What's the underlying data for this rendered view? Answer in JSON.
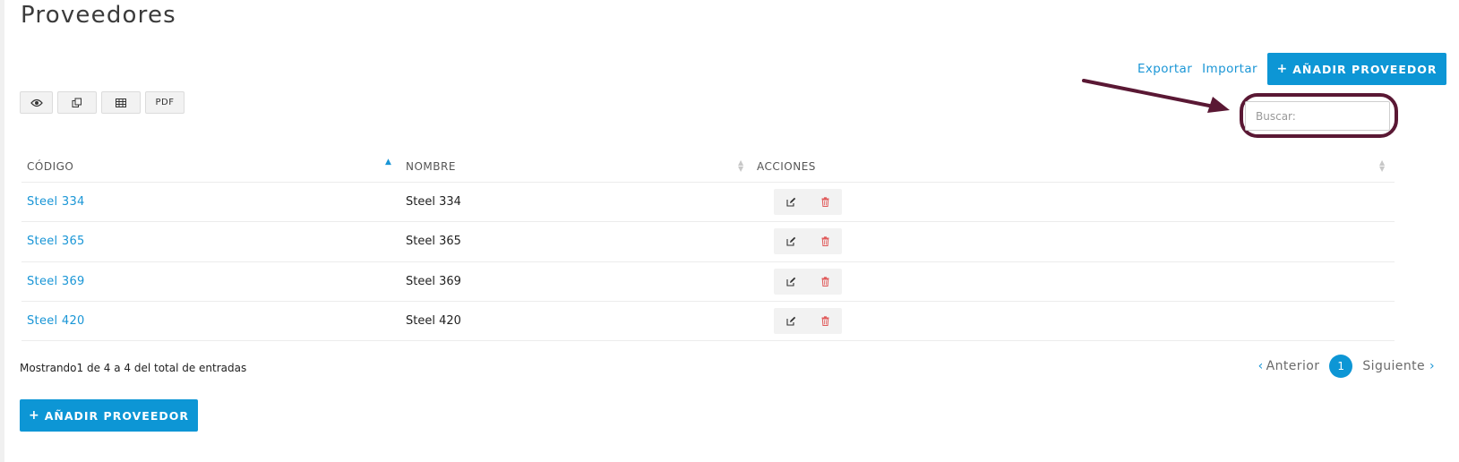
{
  "page": {
    "title": "Proveedores"
  },
  "header_actions": {
    "export_label": "Exportar",
    "import_label": "Importar",
    "add_label": "AÑADIR PROVEEDOR"
  },
  "toolbar": {
    "buttons": [
      {
        "icon": "eye-icon"
      },
      {
        "icon": "copy-icon"
      },
      {
        "icon": "table-icon"
      },
      {
        "label": "PDF"
      }
    ]
  },
  "search": {
    "placeholder": "Buscar:",
    "value": ""
  },
  "table": {
    "columns": [
      "CÓDIGO",
      "NOMBRE",
      "ACCIONES"
    ],
    "sorted_column": "CÓDIGO",
    "sort_direction": "asc",
    "rows": [
      {
        "codigo": "Steel 334",
        "nombre": "Steel 334"
      },
      {
        "codigo": "Steel 365",
        "nombre": "Steel 365"
      },
      {
        "codigo": "Steel 369",
        "nombre": "Steel 369"
      },
      {
        "codigo": "Steel 420",
        "nombre": "Steel 420"
      }
    ]
  },
  "footer": {
    "info": "Mostrando1 de 4 a 4 del total de entradas",
    "add_label": "AÑADIR PROVEEDOR"
  },
  "pagination": {
    "prev_label": "Anterior",
    "current_page": "1",
    "next_label": "Siguiente"
  },
  "colors": {
    "accent": "#0d96d5",
    "annotation": "#5a1834",
    "delete": "#e05a5a"
  }
}
